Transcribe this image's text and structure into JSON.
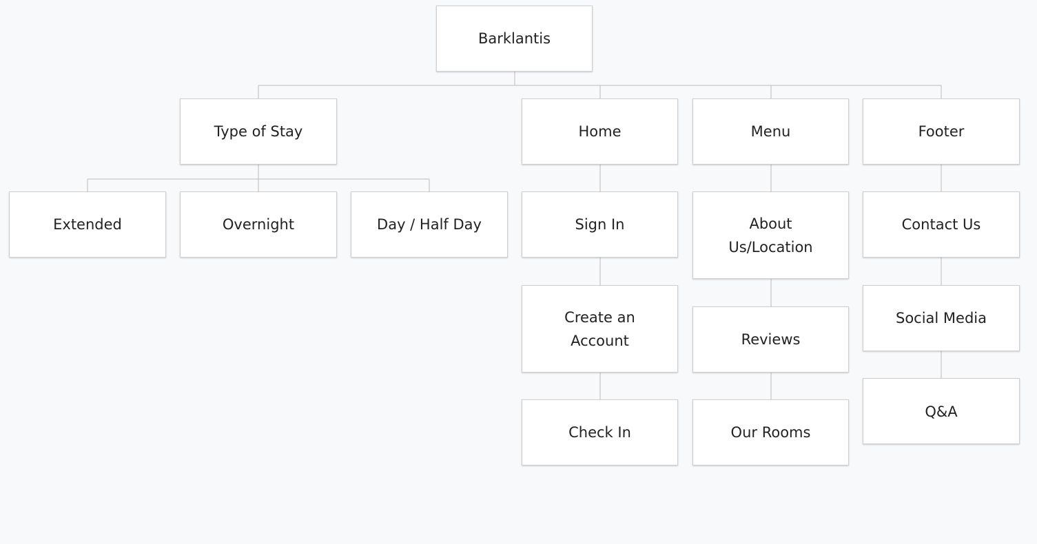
{
  "sitemap": {
    "root": "Barklantis",
    "type_of_stay": {
      "label": "Type of Stay",
      "children": [
        "Extended",
        "Overnight",
        "Day / Half Day"
      ]
    },
    "home": {
      "label": "Home",
      "children": [
        "Sign In",
        "Create an\nAccount",
        "Check In"
      ]
    },
    "menu": {
      "label": "Menu",
      "children": [
        "About\nUs/Location",
        "Reviews",
        "Our Rooms"
      ]
    },
    "footer": {
      "label": "Footer",
      "children": [
        "Contact Us",
        "Social Media",
        "Q&A"
      ]
    }
  },
  "colors": {
    "background": "#f8f9fb",
    "box_fill": "#ffffff",
    "box_border": "#cfcfcf",
    "connector": "#c6c6c6",
    "text": "#222222"
  }
}
